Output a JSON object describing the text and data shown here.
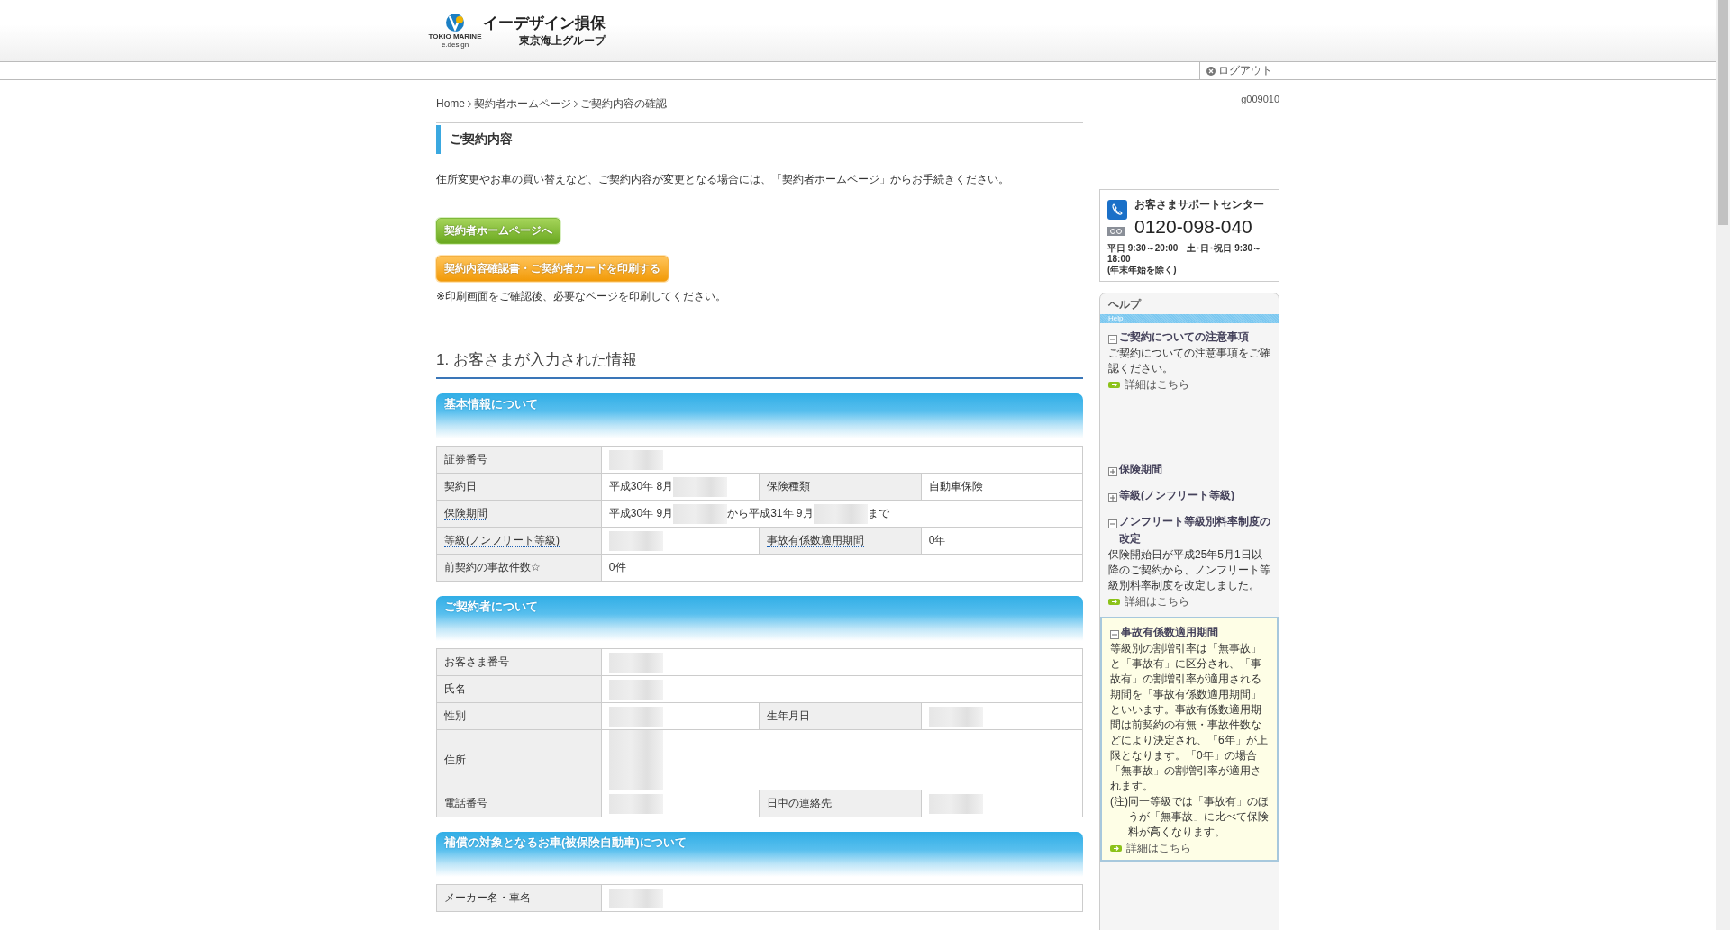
{
  "header": {
    "brand": "イーデザイン損保",
    "group": "東京海上グループ",
    "mark_top": "TOKIO MARINE",
    "mark_bottom": "e.design"
  },
  "nav": {
    "logout": "ログアウト"
  },
  "breadcrumb": [
    {
      "label": "Home"
    },
    {
      "label": "契約者ホームページ"
    },
    {
      "label": "ご契約内容の確認"
    }
  ],
  "page_code": "g009010",
  "page_title": "ご契約内容",
  "intro": "住所変更やお車の買い替えなど、ご契約内容が変更となる場合には、「契約者ホームページ」からお手続きください。",
  "buttons": [
    {
      "label": "契約者ホームページへ",
      "kind": "home"
    },
    {
      "label": "契約内容確認書・ご契約者カードを印刷する",
      "kind": "print"
    }
  ],
  "print_note": "※印刷画面をご確認後、必要なページを印刷してください。",
  "section_heading": "1. お客さまが入力された情報",
  "sections": [
    {
      "title": "基本情報について",
      "rows": [
        {
          "cells": [
            {
              "kind": "label",
              "text": "証券番号",
              "link": false
            },
            {
              "kind": "value",
              "colspan": 3,
              "parts": [
                {
                  "kind": "redacted"
                }
              ]
            }
          ]
        },
        {
          "cells": [
            {
              "kind": "label",
              "text": "契約日",
              "link": false
            },
            {
              "kind": "value",
              "parts": [
                {
                  "kind": "text",
                  "text": "平成30年 8月"
                },
                {
                  "kind": "redacted"
                }
              ]
            },
            {
              "kind": "label",
              "text": "保険種類",
              "link": false
            },
            {
              "kind": "value",
              "parts": [
                {
                  "kind": "text",
                  "text": "自動車保険"
                }
              ]
            }
          ]
        },
        {
          "cells": [
            {
              "kind": "label",
              "text": "保険期間",
              "link": true
            },
            {
              "kind": "value",
              "colspan": 3,
              "parts": [
                {
                  "kind": "text",
                  "text": "平成30年 9月"
                },
                {
                  "kind": "redacted"
                },
                {
                  "kind": "text",
                  "text": "から平成31年 9月"
                },
                {
                  "kind": "redacted"
                },
                {
                  "kind": "text",
                  "text": "まで"
                }
              ]
            }
          ]
        },
        {
          "cells": [
            {
              "kind": "label",
              "text": "等級(ノンフリート等級)",
              "link": true
            },
            {
              "kind": "value",
              "parts": [
                {
                  "kind": "redacted"
                }
              ]
            },
            {
              "kind": "label",
              "text": "事故有係数適用期間",
              "link": true
            },
            {
              "kind": "value",
              "parts": [
                {
                  "kind": "text",
                  "text": "0年"
                }
              ]
            }
          ]
        },
        {
          "cells": [
            {
              "kind": "label",
              "text": "前契約の事故件数☆",
              "link": false
            },
            {
              "kind": "value",
              "colspan": 3,
              "parts": [
                {
                  "kind": "text",
                  "text": "0件"
                }
              ]
            }
          ]
        }
      ]
    },
    {
      "title": "ご契約者について",
      "rows": [
        {
          "cells": [
            {
              "kind": "label",
              "text": "お客さま番号",
              "link": false
            },
            {
              "kind": "value",
              "colspan": 3,
              "parts": [
                {
                  "kind": "redacted"
                }
              ]
            }
          ]
        },
        {
          "cells": [
            {
              "kind": "label",
              "text": "氏名",
              "link": false
            },
            {
              "kind": "value",
              "colspan": 3,
              "parts": [
                {
                  "kind": "redacted"
                }
              ]
            }
          ]
        },
        {
          "cells": [
            {
              "kind": "label",
              "text": "性別",
              "link": false
            },
            {
              "kind": "value",
              "parts": [
                {
                  "kind": "redacted"
                }
              ]
            },
            {
              "kind": "label",
              "text": "生年月日",
              "link": false
            },
            {
              "kind": "value",
              "parts": [
                {
                  "kind": "redacted"
                }
              ]
            }
          ]
        },
        {
          "cells": [
            {
              "kind": "label",
              "text": "住所",
              "link": false
            },
            {
              "kind": "value",
              "colspan": 3,
              "parts": [
                {
                  "kind": "redacted"
                },
                {
                  "kind": "break"
                },
                {
                  "kind": "redacted"
                },
                {
                  "kind": "break"
                },
                {
                  "kind": "redacted"
                }
              ]
            }
          ]
        },
        {
          "cells": [
            {
              "kind": "label",
              "text": "電話番号",
              "link": false
            },
            {
              "kind": "value",
              "parts": [
                {
                  "kind": "redacted"
                }
              ]
            },
            {
              "kind": "label",
              "text": "日中の連絡先",
              "link": false
            },
            {
              "kind": "value",
              "parts": [
                {
                  "kind": "redacted"
                }
              ]
            }
          ]
        }
      ]
    },
    {
      "title": "補償の対象となるお車(被保険自動車)について",
      "rows": [
        {
          "cells": [
            {
              "kind": "label",
              "text": "メーカー名・車名",
              "link": false
            },
            {
              "kind": "value",
              "colspan": 3,
              "parts": [
                {
                  "kind": "redacted"
                }
              ]
            }
          ]
        }
      ]
    }
  ],
  "support": {
    "title": "お客さまサポートセンター",
    "phone": "0120-098-040",
    "hours": "平日 9:30～20:00　土･日･祝日 9:30～18:00",
    "hours_note": "(年末年始を除く)"
  },
  "help": {
    "title": "ヘルプ",
    "band": "Help",
    "items": [
      {
        "title": "ご契約についての注意事項",
        "expanded": true,
        "selected": false,
        "body": "ご契約についての注意事項をご確認ください。",
        "link": "詳細はこちら"
      },
      {
        "title": "保険期間",
        "expanded": false,
        "selected": false
      },
      {
        "title": "等級(ノンフリート等級)",
        "expanded": false,
        "selected": false
      },
      {
        "title": "ノンフリート等級別料率制度の改定",
        "expanded": true,
        "selected": false,
        "body": "保険開始日が平成25年5月1日以降のご契約から、ノンフリート等級別料率制度を改定しました。",
        "link": "詳細はこちら"
      },
      {
        "title": "事故有係数適用期間",
        "expanded": true,
        "selected": true,
        "body": "等級別の割増引率は「無事故」と「事故有」に区分され、「事故有」の割増引率が適用される期間を「事故有係数適用期間」といいます。事故有係数適用期間は前契約の有無・事故件数などにより決定され、「6年」が上限となります。「0年」の場合「無事故」の割増引率が適用されます。",
        "note": {
          "mark": "(注)",
          "text": "同一等級では「事故有」のほうが「無事故」に比べて保険料が高くなります。"
        },
        "link": "詳細はこちら"
      }
    ]
  }
}
